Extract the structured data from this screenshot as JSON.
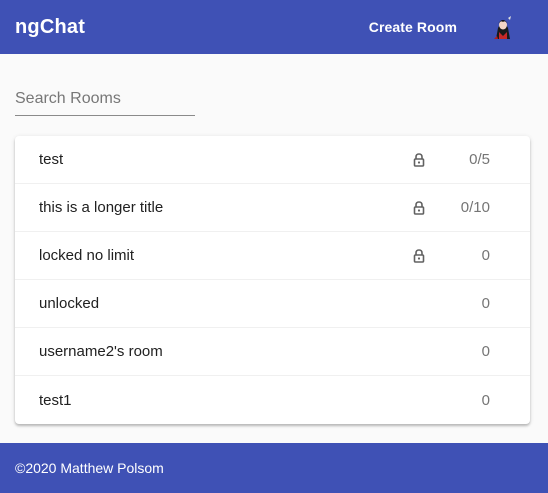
{
  "header": {
    "title": "ngChat",
    "create_room_label": "Create Room",
    "avatar_icon": "user-avatar"
  },
  "search": {
    "placeholder": "Search Rooms",
    "value": ""
  },
  "rooms": [
    {
      "name": "test",
      "locked": true,
      "count": "0/5"
    },
    {
      "name": "this is a longer title",
      "locked": true,
      "count": "0/10"
    },
    {
      "name": "locked no limit",
      "locked": true,
      "count": "0"
    },
    {
      "name": "unlocked",
      "locked": false,
      "count": "0"
    },
    {
      "name": "username2's room",
      "locked": false,
      "count": "0"
    },
    {
      "name": "test1",
      "locked": false,
      "count": "0"
    }
  ],
  "footer": {
    "text": "©2020 Matthew Polsom"
  },
  "colors": {
    "primary": "#3f51b5",
    "background": "#fafafa"
  }
}
